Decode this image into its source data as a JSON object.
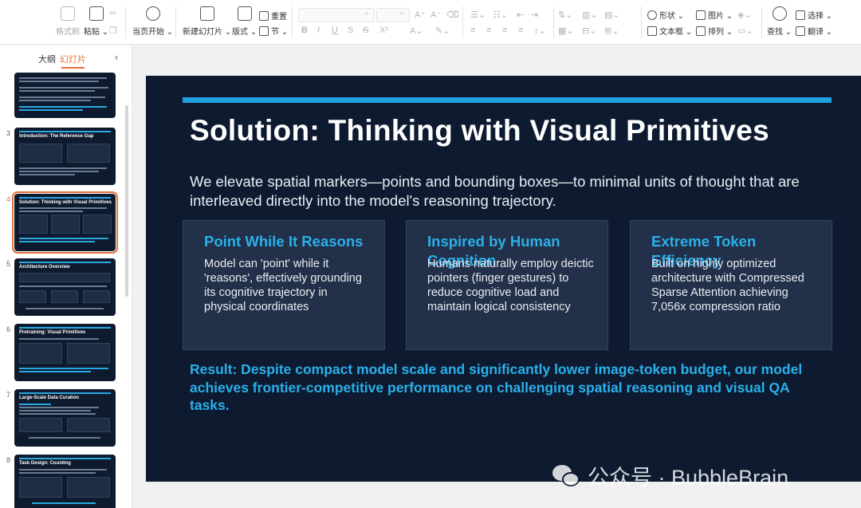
{
  "toolbar": {
    "format_painter": "格式刷",
    "paste": "粘贴",
    "play_from_current": "当页开始",
    "new_slide": "新建幻灯片",
    "layout": "版式",
    "reset": "重置",
    "section": "节",
    "shape": "形状",
    "picture": "图片",
    "textbox": "文本框",
    "arrange": "排列",
    "find": "查找",
    "select": "选择",
    "translate": "翻译"
  },
  "left_panel": {
    "tab_outline": "大纲",
    "tab_slides": "幻灯片",
    "thumbnails": [
      {
        "num": "",
        "title": ""
      },
      {
        "num": "3",
        "title": "Introduction: The Reference Gap"
      },
      {
        "num": "4",
        "title": "Solution: Thinking with Visual Primitives"
      },
      {
        "num": "5",
        "title": "Architecture Overview"
      },
      {
        "num": "6",
        "title": "Pretraining: Visual Primitives"
      },
      {
        "num": "7",
        "title": "Large-Scale Data Curation"
      },
      {
        "num": "8",
        "title": "Task Design: Counting"
      }
    ]
  },
  "slide": {
    "title": "Solution: Thinking with Visual Primitives",
    "subtitle": "We elevate spatial markers—points and bounding boxes—to minimal units of thought that are interleaved directly into the model's reasoning trajectory.",
    "cards": [
      {
        "title": "Point While It Reasons",
        "body": "Model can 'point' while it 'reasons', effectively grounding its cognitive trajectory in physical coordinates"
      },
      {
        "title": "Inspired by Human Cognition",
        "body": "Humans naturally employ deictic pointers (finger gestures) to reduce cognitive load and maintain logical consistency"
      },
      {
        "title": "Extreme Token Efficiency",
        "body": "Built on highly optimized architecture with Compressed Sparse Attention achieving 7,056x compression ratio"
      }
    ],
    "result": "Result: Despite compact model scale and significantly lower image-token budget, our model achieves frontier-competitive performance on challenging spatial reasoning and visual QA tasks."
  },
  "watermark": "公众号 · BubbleBrain",
  "colors": {
    "accent": "#1fa2dc",
    "slide_bg": "#0d1a30",
    "card_bg": "#233049",
    "selection": "#e5703a"
  }
}
